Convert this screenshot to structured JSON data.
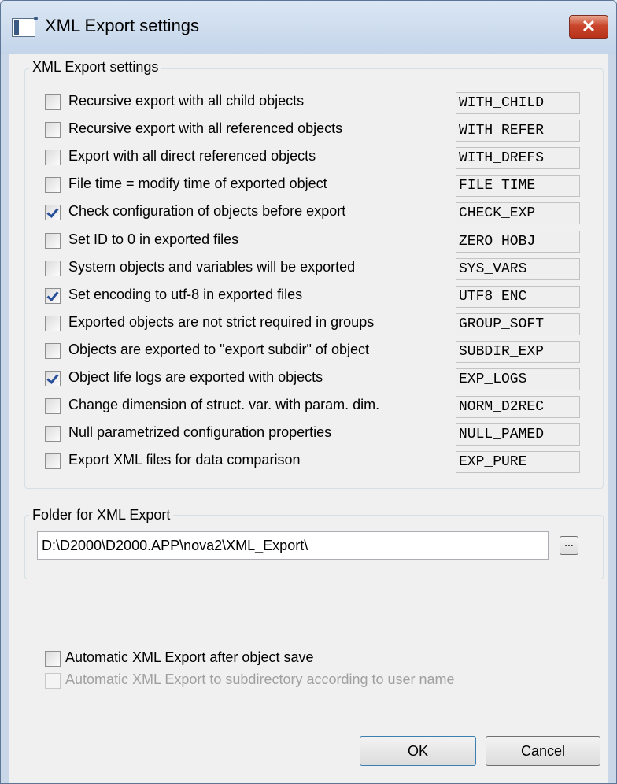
{
  "window": {
    "title": "XML Export settings",
    "icon": "app-window-icon",
    "close_icon": "close-x-icon",
    "close_symbol": "✕"
  },
  "settings_group": {
    "legend": "XML Export settings",
    "options": [
      {
        "label": "Recursive export with all child objects",
        "code": "WITH_CHILD",
        "checked": false
      },
      {
        "label": "Recursive export with all referenced objects",
        "code": "WITH_REFER",
        "checked": false
      },
      {
        "label": "Export with all direct referenced objects",
        "code": "WITH_DREFS",
        "checked": false
      },
      {
        "label": "File time = modify time of exported object",
        "code": "FILE_TIME",
        "checked": false
      },
      {
        "label": "Check configuration of objects before export",
        "code": "CHECK_EXP",
        "checked": true
      },
      {
        "label": "Set ID to 0 in exported files",
        "code": "ZERO_HOBJ",
        "checked": false
      },
      {
        "label": "System objects and variables will be exported",
        "code": "SYS_VARS",
        "checked": false
      },
      {
        "label": "Set encoding to utf-8 in exported files",
        "code": "UTF8_ENC",
        "checked": true
      },
      {
        "label": "Exported objects are not strict required in groups",
        "code": "GROUP_SOFT",
        "checked": false
      },
      {
        "label": "Objects are exported to \"export subdir\" of object",
        "code": "SUBDIR_EXP",
        "checked": false
      },
      {
        "label": "Object life logs are exported with objects",
        "code": "EXP_LOGS",
        "checked": true
      },
      {
        "label": "Change dimension of struct. var. with param. dim.",
        "code": "NORM_D2REC",
        "checked": false
      },
      {
        "label": "Null parametrized configuration properties",
        "code": "NULL_PAMED",
        "checked": false
      },
      {
        "label": "Export XML files for data comparison",
        "code": "EXP_PURE",
        "checked": false
      }
    ]
  },
  "folder_group": {
    "legend": "Folder for XML Export",
    "path_value": "D:\\D2000\\D2000.APP\\nova2\\XML_Export\\",
    "browse_label": "..."
  },
  "auto_export": {
    "label": "Automatic XML Export after object save",
    "checked": false,
    "enabled": true
  },
  "auto_subdir": {
    "label": "Automatic XML Export to subdirectory according to user name",
    "checked": false,
    "enabled": false
  },
  "buttons": {
    "ok": "OK",
    "cancel": "Cancel"
  },
  "colors": {
    "title_bar": "#c9d7e8",
    "close_button": "#c9462c",
    "dialog_bg": "#f0f0f0",
    "disabled_text": "#a0a0a0",
    "checkmark": "#2a4f9a"
  }
}
